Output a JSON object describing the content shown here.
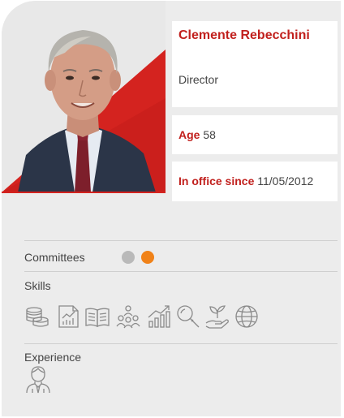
{
  "profile": {
    "name": "Clemente Rebecchini",
    "role": "Director",
    "age_label": "Age",
    "age_value": "58",
    "office_label": "In office since",
    "office_value": "11/05/2012",
    "photo_icon": "portrait-photo"
  },
  "committees": {
    "label": "Committees",
    "dots": [
      {
        "name": "committee-grey",
        "color": "#b9b9b9"
      },
      {
        "name": "committee-orange",
        "color": "#f08219"
      }
    ]
  },
  "skills": {
    "label": "Skills",
    "icons": [
      "coins-icon",
      "financial-report-icon",
      "open-book-icon",
      "team-icon",
      "growth-chart-icon",
      "magnifier-icon",
      "plant-hand-icon",
      "globe-icon"
    ]
  },
  "experience": {
    "label": "Experience",
    "icons": [
      "executive-person-icon"
    ]
  },
  "colors": {
    "accent": "#c1201d",
    "card_bg": "#ececec",
    "icon_stroke": "#888888"
  }
}
